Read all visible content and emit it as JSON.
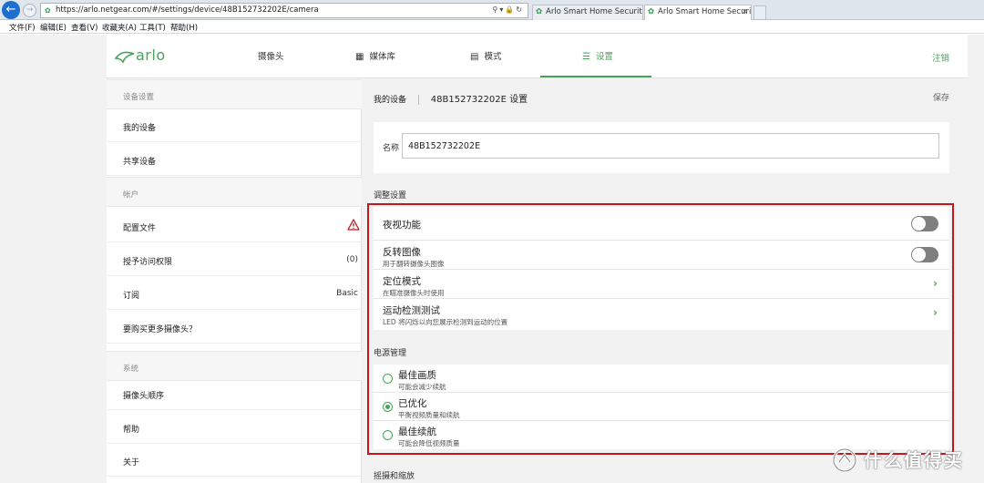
{
  "browser": {
    "url": "https://arlo.netgear.com/#/settings/device/48B152732202E/camera",
    "tabs": [
      {
        "title": "Arlo Smart Home Security C..."
      },
      {
        "title": "Arlo Smart Home Securit..."
      }
    ],
    "tab_close": "×",
    "menu": [
      "文件(F)",
      "编辑(E)",
      "查看(V)",
      "收藏夹(A)",
      "工具(T)",
      "帮助(H)"
    ]
  },
  "nav": {
    "logo": "arlo",
    "items": [
      {
        "label": "摄像头"
      },
      {
        "label": "媒体库"
      },
      {
        "label": "模式"
      },
      {
        "label": "设置"
      }
    ],
    "active": "设置",
    "logout": "注销"
  },
  "sidebar": {
    "sections": [
      {
        "title": "设备设置",
        "items": [
          {
            "label": "我的设备"
          },
          {
            "label": "共享设备"
          }
        ]
      },
      {
        "title": "帐户",
        "items": [
          {
            "label": "配置文件",
            "icon": "warning-icon"
          },
          {
            "label": "授予访问权限",
            "value": "(0)"
          },
          {
            "label": "订阅",
            "value": "Basic"
          },
          {
            "label": "要购买更多摄像头？"
          }
        ]
      },
      {
        "title": "系统",
        "items": [
          {
            "label": "摄像头顺序"
          },
          {
            "label": "帮助"
          },
          {
            "label": "关于"
          }
        ]
      }
    ]
  },
  "main": {
    "breadcrumb": {
      "parent": "我的设备",
      "title": "48B152732202E 设置"
    },
    "save": "保存",
    "name_label": "名称",
    "name_value": "48B152732202E",
    "adjust": {
      "title": "调整设置",
      "rows": [
        {
          "title": "夜视功能",
          "subtitle": "",
          "control": "toggle",
          "state": "off"
        },
        {
          "title": "反转图像",
          "subtitle": "用于翻转摄像头图像",
          "control": "toggle",
          "state": "off"
        },
        {
          "title": "定位模式",
          "subtitle": "在瞄准摄像头时使用",
          "control": "chevron"
        },
        {
          "title": "运动检测测试",
          "subtitle": "LED 将闪烁以向您展示检测到运动的位置",
          "control": "chevron"
        }
      ]
    },
    "power": {
      "title": "电源管理",
      "options": [
        {
          "title": "最佳画质",
          "subtitle": "可能会减少续航",
          "selected": false
        },
        {
          "title": "已优化",
          "subtitle": "平衡视频质量和续航",
          "selected": true
        },
        {
          "title": "最佳续航",
          "subtitle": "可能会降低视频质量",
          "selected": false
        }
      ]
    },
    "next_section": "摇摄和缩放"
  },
  "watermark": "什么值得买",
  "colors": {
    "accent": "#48a35a",
    "highlight": "#c4161c",
    "toggle_off": "#7f7f7f"
  }
}
